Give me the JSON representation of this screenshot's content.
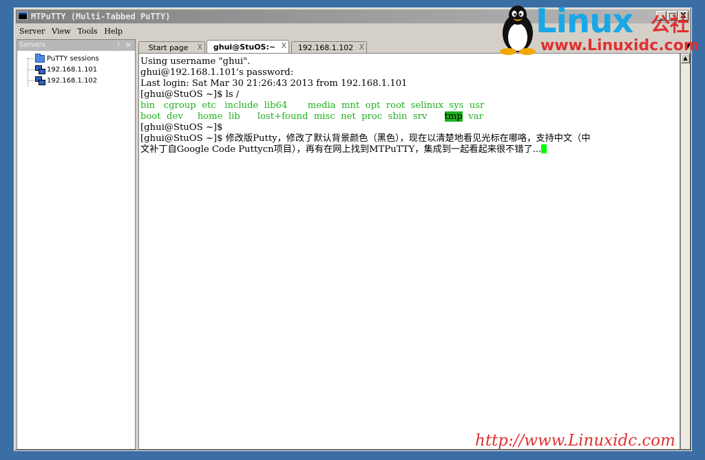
{
  "window": {
    "title": "MTPuTTY (Multi-Tabbed PuTTY)",
    "min": "_",
    "max": "□",
    "close": "X"
  },
  "menu": [
    "Server",
    "View",
    "Tools",
    "Help"
  ],
  "sidebar": {
    "title": "Servers",
    "pin": "ᚹ",
    "close": "✕",
    "root": "PuTTY sessions",
    "items": [
      "192.168.1.101",
      "192.168.1.102"
    ]
  },
  "tabs": [
    {
      "label": "Start page",
      "close": "X"
    },
    {
      "label": "ghui@StuOS:~",
      "close": "X"
    },
    {
      "label": "192.168.1.102",
      "close": "X"
    }
  ],
  "terminal": {
    "line1": "Using username \"ghui\".",
    "line2": "ghui@192.168.1.101's password:",
    "line3": "Last login: Sat Mar 30 21:26:43 2013 from 192.168.1.101",
    "line4": "[ghui@StuOS ~]$ ls /",
    "ls_row1": [
      "bin",
      "cgroup",
      "etc",
      "include",
      "lib64",
      "media",
      "mnt",
      "opt",
      "root",
      "selinux",
      "sys",
      "usr"
    ],
    "ls_row2": [
      "boot",
      "dev",
      "home",
      "lib",
      "lost+found",
      "misc",
      "net",
      "proc",
      "sbin",
      "srv",
      "tmp",
      "var"
    ],
    "line7": "[ghui@StuOS ~]$",
    "line8": "[ghui@StuOS ~]$ 修改版Putty，修改了默认背景颜色（黑色），现在以清楚地看见光标在哪咯，支持中文（中",
    "line9": "文补丁自Google Code Puttycn项目），再有在网上找到MTPuTTY，集成到一起看起来很不错了..."
  },
  "watermark": {
    "logo": "Linux",
    "logo_cn": "公社",
    "url": "www.Linuxidc.com",
    "bottom_url": "http://www.Linuxidc.com"
  },
  "colors": {
    "desktop": "#3a6ea5",
    "ls_green": "#1eb21e",
    "cursor": "#00ff00",
    "watermark_blue": "#1aa7e6",
    "watermark_red": "#e03030"
  }
}
